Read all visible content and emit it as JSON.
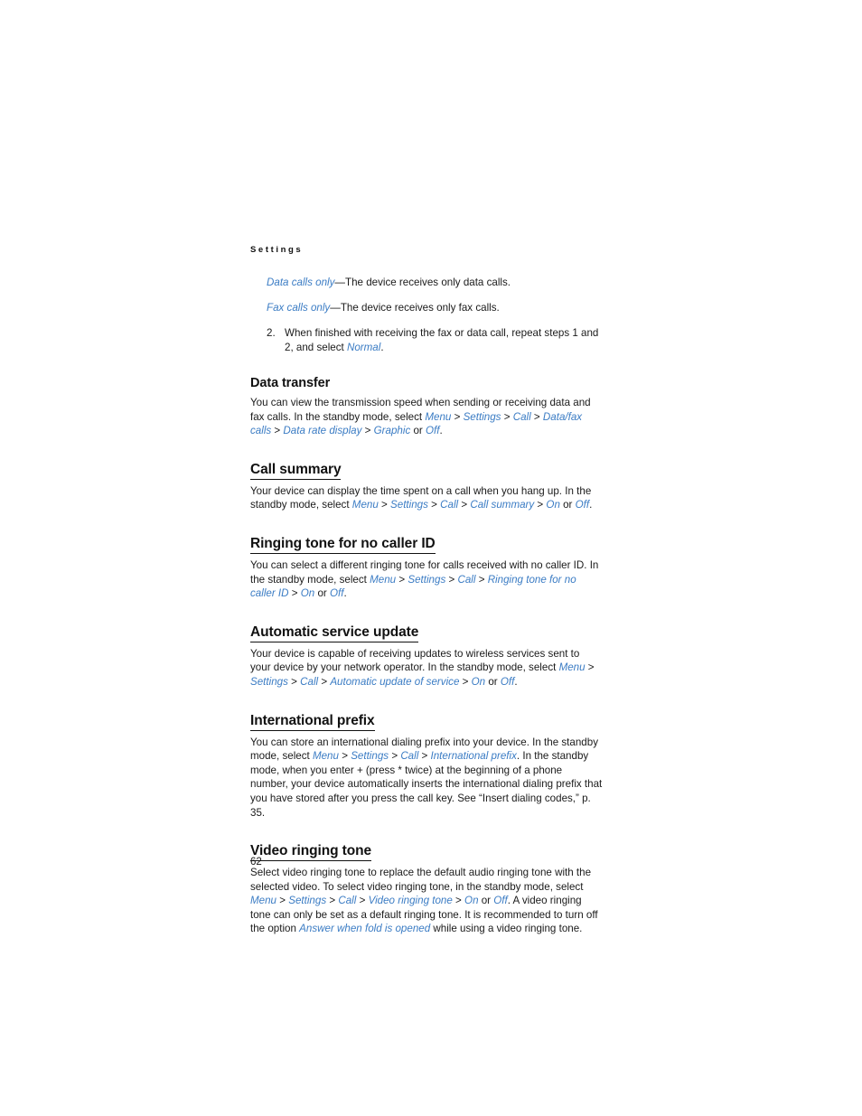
{
  "page": {
    "running_header": "Settings",
    "page_number": "62",
    "accent_color": "#3b7cc4",
    "text_color": "#1a1a1a"
  },
  "definitions": [
    {
      "term": "Data calls only",
      "dash": "—",
      "description": "The device receives only data calls."
    },
    {
      "term": "Fax calls only",
      "dash": "—",
      "description": "The device receives only fax calls."
    }
  ],
  "step": {
    "number": "2.",
    "text_before": "When finished with receiving the fax or data call, repeat steps 1 and 2, and select ",
    "ui_term": "Normal",
    "text_after": "."
  },
  "sections": [
    {
      "id": "data-transfer",
      "heading": "Data transfer",
      "underlined": false,
      "paragraph": {
        "p1": "You can view the transmission speed when sending or receiving data and fax calls. In the standby mode, select ",
        "ui1": "Menu",
        "sep1": " > ",
        "ui2": "Settings",
        "sep2": " > ",
        "ui3": "Call",
        "sep3": " > ",
        "ui4": "Data/fax calls",
        "sep4": " > ",
        "ui5": "Data rate display",
        "sep5": " > ",
        "ui6": "Graphic",
        "sep6": " or ",
        "ui7": "Off",
        "p2": "."
      }
    },
    {
      "id": "call-summary",
      "heading": "Call summary",
      "underlined": true,
      "paragraph": {
        "p1": "Your device can display the time spent on a call when you hang up. In the standby mode, select ",
        "ui1": "Menu",
        "sep1": " > ",
        "ui2": "Settings",
        "sep2": " > ",
        "ui3": "Call",
        "sep3": " > ",
        "ui4": "Call summary",
        "sep4": " > ",
        "ui5": "On",
        "sep5": " or ",
        "ui6": "Off",
        "p2": "."
      }
    },
    {
      "id": "ringing-tone-no-caller-id",
      "heading": "Ringing tone for no caller ID",
      "underlined": true,
      "paragraph": {
        "p1": "You can select a different ringing tone for calls received with no caller ID. In the standby mode, select ",
        "ui1": "Menu",
        "sep1": " > ",
        "ui2": "Settings",
        "sep2": " > ",
        "ui3": "Call",
        "sep3": " > ",
        "ui4": "Ringing tone for no caller ID",
        "sep4": " > ",
        "ui5": "On",
        "sep5": " or ",
        "ui6": "Off",
        "p2": "."
      }
    },
    {
      "id": "automatic-service-update",
      "heading": "Automatic service update",
      "underlined": true,
      "paragraph": {
        "p1": "Your device is capable of receiving updates to wireless services sent to your device by your network operator. In the standby mode, select ",
        "ui1": "Menu",
        "sep1": " > ",
        "ui2": "Settings",
        "sep2": " > ",
        "ui3": "Call",
        "sep3": " > ",
        "ui4": "Automatic update of service",
        "sep4": " > ",
        "ui5": "On",
        "sep5": " or ",
        "ui6": "Off",
        "p2": "."
      }
    },
    {
      "id": "international-prefix",
      "heading": "International prefix",
      "underlined": true,
      "paragraph": {
        "p1": "You can store an international dialing prefix into your device. In the standby mode, select ",
        "ui1": "Menu",
        "sep1": " > ",
        "ui2": "Settings",
        "sep2": " > ",
        "ui3": "Call",
        "sep3": " > ",
        "ui4": "International prefix",
        "p2": ". In the standby mode, when you enter + (press * twice) at the beginning of a phone number, your device automatically inserts the international dialing prefix that you have stored after you press the call key. See “Insert dialing codes,” p. 35."
      }
    },
    {
      "id": "video-ringing-tone",
      "heading": "Video ringing tone",
      "underlined": true,
      "paragraph": {
        "p1": "Select video ringing tone to replace the default audio ringing tone with the selected video. To select video ringing tone, in the standby mode, select ",
        "ui1": "Menu",
        "sep1": " > ",
        "ui2": "Settings",
        "sep2": " > ",
        "ui3": "Call",
        "sep3": " > ",
        "ui4": "Video ringing tone",
        "sep4": " > ",
        "ui5": "On",
        "sep5": " or ",
        "ui6": "Off",
        "p2": ". A video ringing tone can only be set as a default ringing tone. It is recommended to turn off the option ",
        "ui7": "Answer when fold is opened",
        "p3": " while using a video ringing tone."
      }
    }
  ]
}
